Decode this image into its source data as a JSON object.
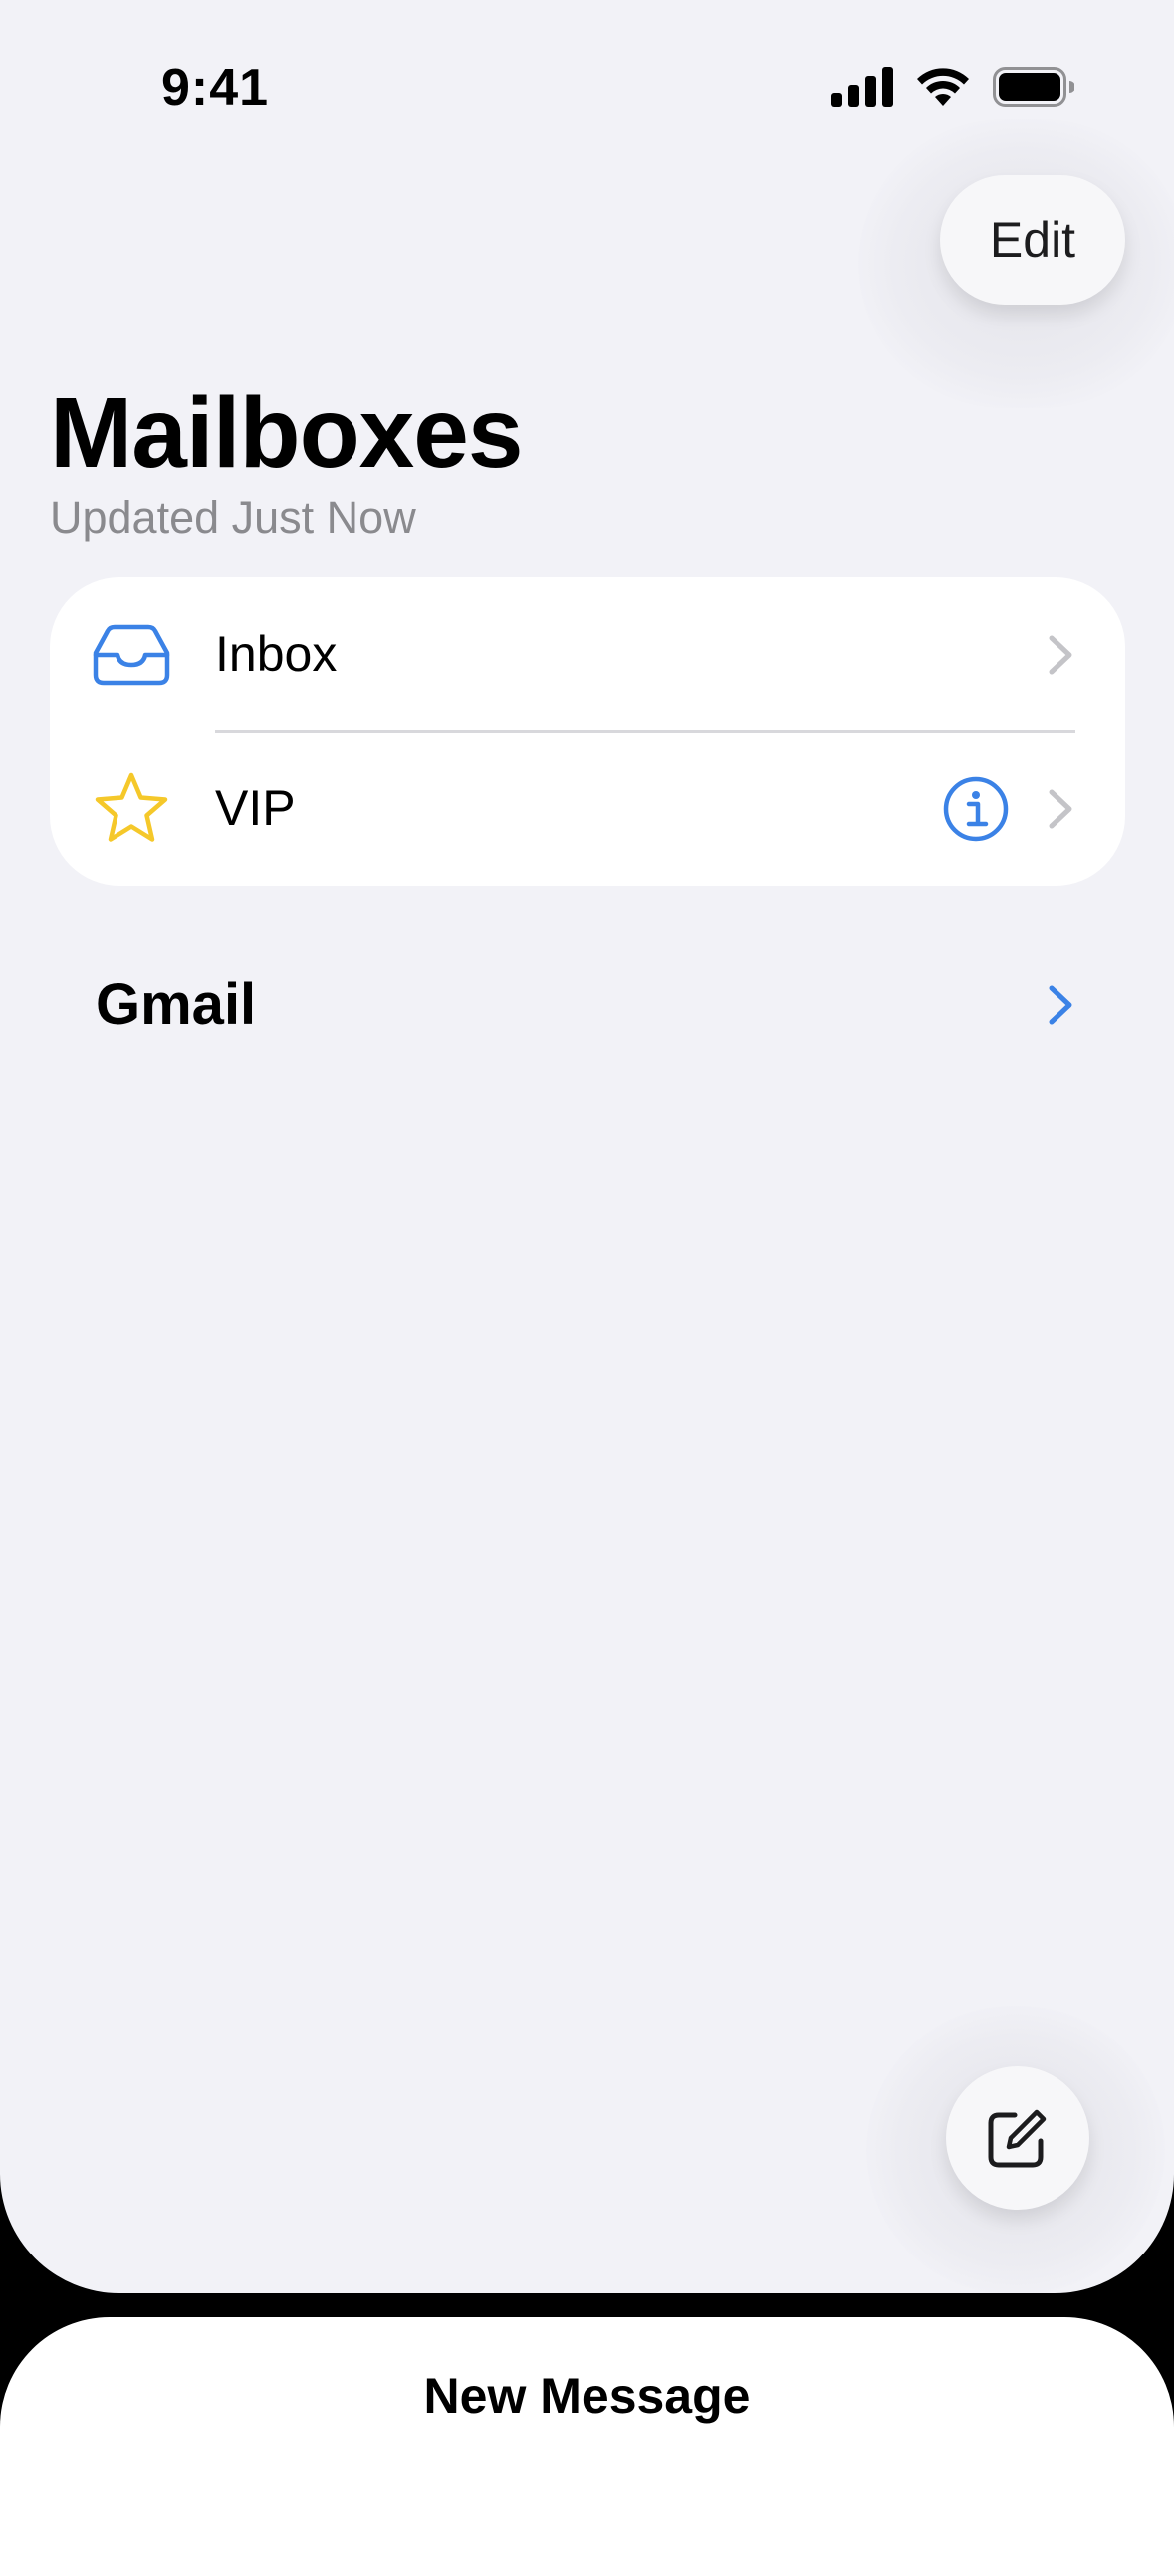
{
  "status_bar": {
    "time": "9:41",
    "icons": [
      "cellular-signal-icon",
      "wifi-icon",
      "battery-icon"
    ]
  },
  "header": {
    "edit_label": "Edit",
    "title": "Mailboxes",
    "subtitle": "Updated Just Now"
  },
  "mailboxes": {
    "items": [
      {
        "label": "Inbox",
        "icon": "inbox-tray-icon"
      },
      {
        "label": "VIP",
        "icon": "star-icon",
        "has_info": true
      }
    ]
  },
  "accounts": {
    "items": [
      {
        "label": "Gmail"
      }
    ]
  },
  "compose": {
    "icon": "compose-icon"
  },
  "sheet": {
    "title": "New Message"
  },
  "colors": {
    "background": "#f2f2f7",
    "accent": "#3b82e6",
    "star": "#f5c82a",
    "secondary_text": "#8a8a8e",
    "chevron": "#c4c4c8"
  }
}
